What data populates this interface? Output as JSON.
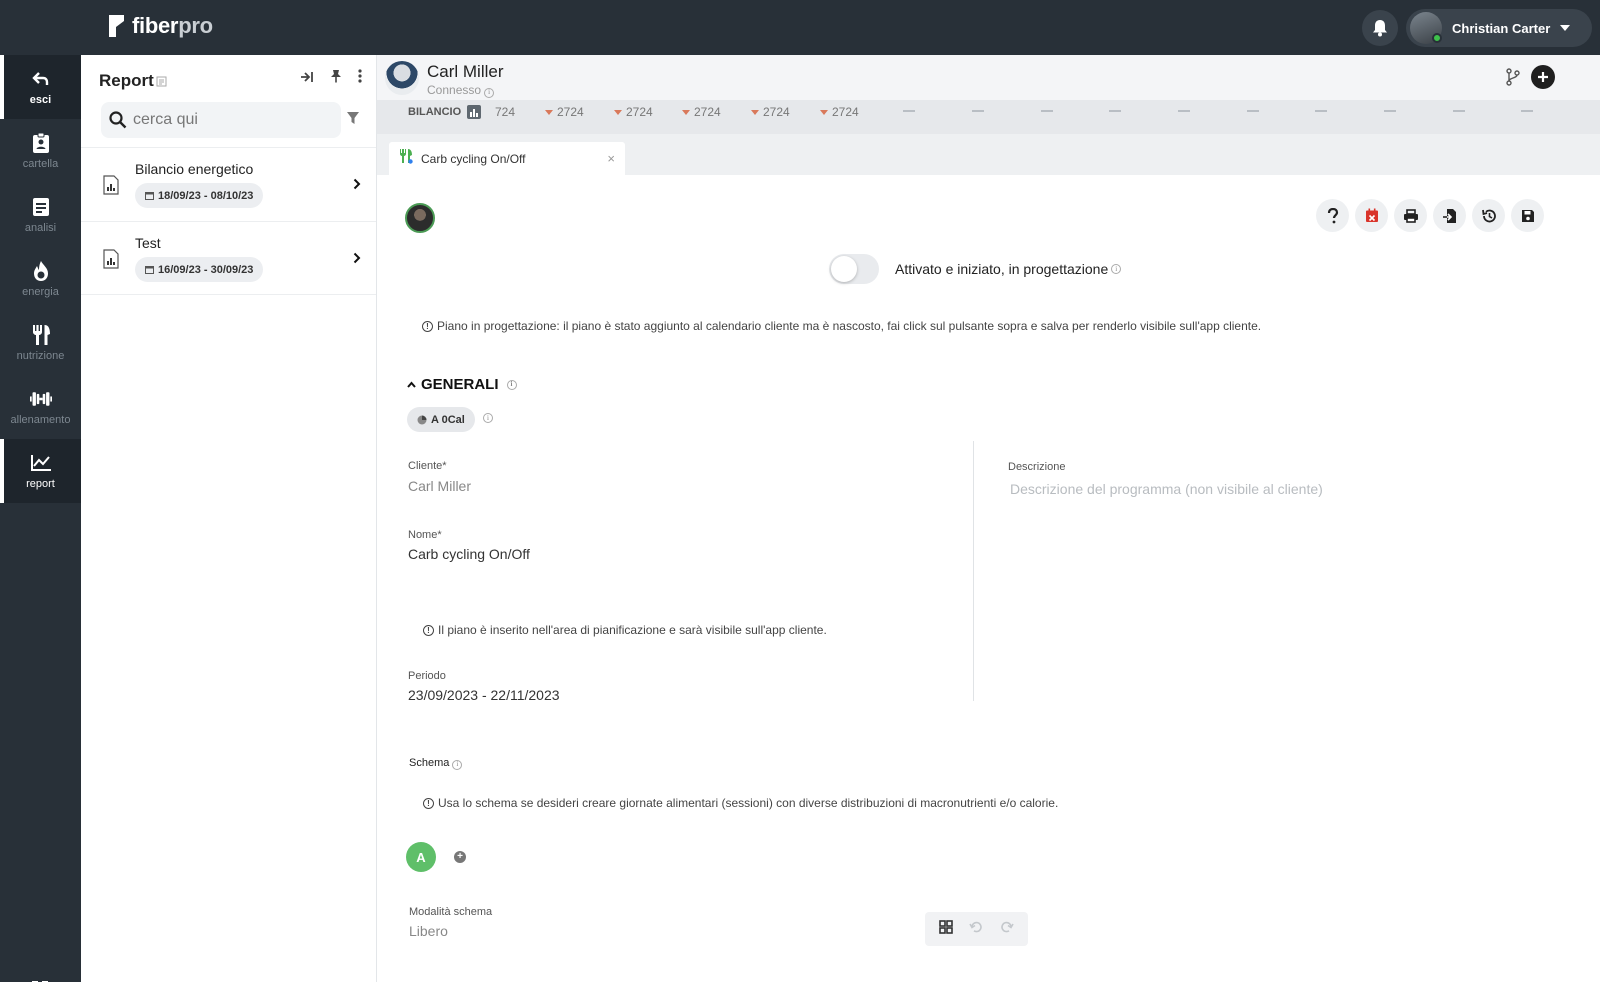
{
  "app": {
    "logo_main": "fiber",
    "logo_pro": "pro"
  },
  "topbar": {
    "user_name": "Christian Carter"
  },
  "leftnav": {
    "items": [
      {
        "label": "esci",
        "icon": "back-arrow-icon"
      },
      {
        "label": "cartella",
        "icon": "clipboard-icon"
      },
      {
        "label": "analisi",
        "icon": "document-icon"
      },
      {
        "label": "energia",
        "icon": "flame-icon"
      },
      {
        "label": "nutrizione",
        "icon": "fork-knife-icon"
      },
      {
        "label": "allenamento",
        "icon": "dumbbell-icon"
      },
      {
        "label": "report",
        "icon": "chart-icon"
      }
    ],
    "active": "report"
  },
  "report_panel": {
    "title": "Report",
    "search_placeholder": "cerca qui",
    "items": [
      {
        "name": "Bilancio energetico",
        "dates": "18/09/23 - 08/10/23"
      },
      {
        "name": "Test",
        "dates": "16/09/23 - 30/09/23"
      }
    ]
  },
  "client": {
    "name": "Carl Miller",
    "status": "Connesso"
  },
  "bilancio": {
    "label": "BILANCIO",
    "first_value": "724",
    "values": [
      "2724",
      "2724",
      "2724",
      "2724",
      "2724"
    ]
  },
  "tab": {
    "label": "Carb cycling On/Off",
    "close": "×"
  },
  "toggle": {
    "label": "Attivato e iniziato, in progettazione",
    "on": false
  },
  "notes": {
    "plan_design": "Piano in progettazione: il piano è stato aggiunto al calendario cliente ma è nascosto, fai click sul pulsante sopra e salva per renderlo visibile sull'app cliente.",
    "plan_inserted": "Il piano è inserito nell'area di pianificazione e sarà visibile sull'app cliente.",
    "schema_hint": "Usa lo schema se desideri creare giornate alimentari (sessioni) con diverse distribuzioni di macronutrienti e/o calorie."
  },
  "generali": {
    "title": "GENERALI",
    "pill": "A 0Cal",
    "cliente_label": "Cliente*",
    "cliente_value": "Carl Miller",
    "nome_label": "Nome*",
    "nome_value": "Carb cycling On/Off",
    "periodo_label": "Periodo",
    "periodo_value": "23/09/2023 - 22/11/2023",
    "descrizione_label": "Descrizione",
    "descrizione_placeholder": "Descrizione del programma (non visibile al cliente)"
  },
  "schema": {
    "label": "Schema",
    "session_letter": "A",
    "add": "+",
    "modalita_label": "Modalità schema",
    "modalita_value": "Libero"
  },
  "colors": {
    "sidebar": "#283038",
    "accent_green": "#5fbf69",
    "trend_down": "#d9795b"
  }
}
